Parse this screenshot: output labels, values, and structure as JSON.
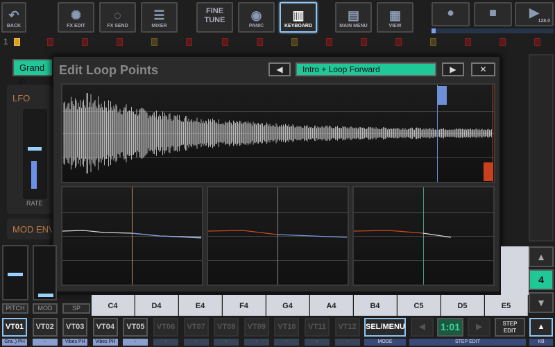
{
  "toolbar": {
    "back": "BACK",
    "fx_edit": "FX EDIT",
    "fx_send": "FX SEND",
    "mixer": "MIXER",
    "fine_tune": "FINE TUNE",
    "panic": "PANIC",
    "keyboard": "KEYBOARD",
    "main_menu": "MAIN MENU",
    "view": "VIEW",
    "tempo": "128.0"
  },
  "pattern_row": {
    "number": "1"
  },
  "background": {
    "instrument": "Grand P",
    "lfo": "LFO",
    "rate": "RATE",
    "mod_env": "MOD ENV"
  },
  "dialog": {
    "title": "Edit Loop Points",
    "loop_mode": "Intro + Loop Forward",
    "prev": "◀",
    "next": "▶",
    "close": "✕"
  },
  "keyboard": {
    "keys": [
      "C4",
      "D4",
      "E4",
      "F4",
      "G4",
      "A4",
      "B4",
      "C5",
      "D5",
      "E5"
    ],
    "octave": "4"
  },
  "sliders": {
    "pitch": "PITCH",
    "mod": "MOD",
    "sp": "SP"
  },
  "tracks": [
    {
      "name": "VT01",
      "label": "Gra..) PH"
    },
    {
      "name": "VT02",
      "label": "-"
    },
    {
      "name": "VT03",
      "label": "Vibes PH"
    },
    {
      "name": "VT04",
      "label": "Vibes PH"
    },
    {
      "name": "VT05",
      "label": "-"
    },
    {
      "name": "VT06",
      "label": "-"
    },
    {
      "name": "VT07",
      "label": "-"
    },
    {
      "name": "VT08",
      "label": "-"
    },
    {
      "name": "VT09",
      "label": "-"
    },
    {
      "name": "VT10",
      "label": "-"
    },
    {
      "name": "VT11",
      "label": "-"
    },
    {
      "name": "VT12",
      "label": "-"
    }
  ],
  "bottom": {
    "sel_menu": "SEL/MENU",
    "mode": "MODE",
    "position": "1:01",
    "step_edit_btn": "STEP EDIT",
    "step_edit": "STEP EDIT",
    "kb": "KB"
  },
  "colors": {
    "accent": "#8fc4f0",
    "green": "#1fc896",
    "loop_start": "#6d8fd8",
    "loop_end": "#c8401c"
  }
}
